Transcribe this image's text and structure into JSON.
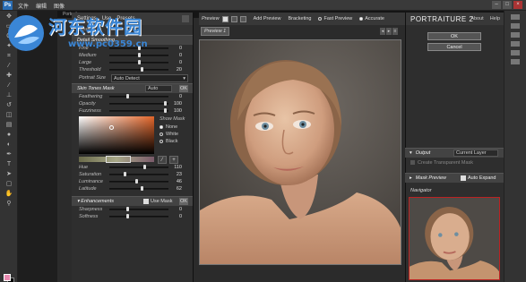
{
  "photoshop": {
    "logo": "Ps",
    "menu": [
      "文件",
      "编辑",
      "图像"
    ],
    "window_controls": [
      "–",
      "□",
      "×"
    ]
  },
  "portraiture": {
    "title": "Portraiture",
    "left_tabs": [
      "Settings",
      "Use",
      "Presets"
    ],
    "sub_header": "Reset",
    "detail_smoothing": {
      "header": "Detail Smoothing",
      "sliders": [
        {
          "label": "Fine",
          "value": "0",
          "pct": 0.5
        },
        {
          "label": "Medium",
          "value": "0",
          "pct": 0.5
        },
        {
          "label": "Large",
          "value": "0",
          "pct": 0.5
        },
        {
          "label": "Threshold",
          "value": "20",
          "pct": 0.55
        }
      ],
      "portrait_size_label": "Portrait Size",
      "portrait_size_value": "Auto Detect"
    },
    "skin_tones_mask": {
      "header": "Skin Tones Mask",
      "mode": "Auto",
      "ok_label": "OK",
      "sliders": [
        {
          "label": "Feathering",
          "value": "0",
          "pct": 0.3
        },
        {
          "label": "Opacity",
          "value": "100",
          "pct": 0.95
        },
        {
          "label": "Fuzziness",
          "value": "100",
          "pct": 0.95
        }
      ],
      "show_mask_label": "Show Mask",
      "radios": [
        {
          "label": "None",
          "on": true
        },
        {
          "label": "White",
          "on": false
        },
        {
          "label": "Black",
          "on": false
        }
      ],
      "color_sliders": [
        {
          "label": "Hue",
          "value": "110",
          "pct": 0.6
        },
        {
          "label": "Saturation",
          "value": "23",
          "pct": 0.25
        },
        {
          "label": "Luminance",
          "value": "46",
          "pct": 0.45
        },
        {
          "label": "Latitude",
          "value": "62",
          "pct": 0.55
        }
      ]
    },
    "enhancements": {
      "header": "Enhancements",
      "use_mask_label": "Use Mask",
      "ok_label": "OK",
      "sliders": [
        {
          "label": "Sharpness",
          "value": "0",
          "pct": 0.3
        },
        {
          "label": "Softness",
          "value": "0",
          "pct": 0.3
        }
      ]
    },
    "preview_toolbar": {
      "label": "Preview",
      "add_preview": "Add Preview",
      "bracketing": "Bracketing",
      "fast_preview": "Fast Preview",
      "accurate": "Accurate"
    },
    "preview_tab": "Preview 1",
    "brand": "PORTRAITURE 2",
    "about": "About",
    "help": "Help",
    "ok_button": "OK",
    "cancel_button": "Cancel",
    "output": {
      "label": "Output",
      "value": "Current Layer",
      "create_transparent": "Create Transparent Mask"
    },
    "mask_preview": {
      "label": "Mask Preview",
      "auto_expand": "Auto Expand"
    },
    "navigator_label": "Navigator"
  },
  "watermark": {
    "site_name": "河东软件园",
    "url": "www.pc0359.cn"
  }
}
